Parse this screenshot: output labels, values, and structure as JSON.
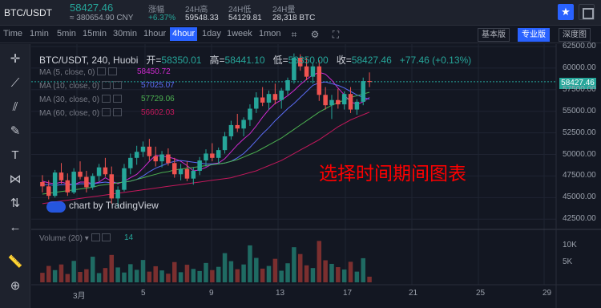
{
  "ticker": {
    "pair": "BTC/USDT",
    "price": "58427.46",
    "cny": "≈ 380654.90 CNY",
    "change_label": "涨幅",
    "change_value": "+6.37%",
    "high_label": "24H高",
    "high_value": "59548.33",
    "low_label": "24H低",
    "low_value": "54129.81",
    "volume_label": "24H量",
    "volume_value": "28,318 BTC"
  },
  "toolbar": {
    "time": "Time",
    "timeframes": [
      "1min",
      "5min",
      "15min",
      "30min",
      "1hour",
      "4hour",
      "1day",
      "1week",
      "1mon"
    ],
    "active_timeframe": "4hour",
    "views": [
      "基本版",
      "专业版",
      "深度图"
    ],
    "active_view": "专业版"
  },
  "legend": {
    "symbol": "BTC/USDT, 240, Huobi",
    "open_label": "开=",
    "open": "58350.01",
    "high_label": "高=",
    "high": "58441.10",
    "low_label": "低=",
    "low": "58350.00",
    "close_label": "收=",
    "close": "58427.46",
    "change": "+77.46 (+0.13%)",
    "ma": [
      {
        "label": "MA (5, close, 0)",
        "value": "58450.72",
        "color": "#d02ad0"
      },
      {
        "label": "MA (10, close, 0)",
        "value": "57025.07",
        "color": "#5b6cf5"
      },
      {
        "label": "MA (30, close, 0)",
        "value": "57729.06",
        "color": "#4caf50"
      },
      {
        "label": "MA (60, close, 0)",
        "value": "56602.03",
        "color": "#c2185b"
      }
    ],
    "volume_label": "Volume (20)",
    "volume_value": "14"
  },
  "watermark": "chart by TradingView",
  "overlay_text": "选择时间期间图表",
  "price_tag": "58427.46",
  "colors": {
    "up": "#26a69a",
    "down": "#ef5350",
    "accent": "#2962ff"
  },
  "icons": [
    "star-icon",
    "fullscreen-icon",
    "crosshair-icon",
    "trendline-icon",
    "fib-icon",
    "brush-icon",
    "text-icon",
    "pattern-icon",
    "measure-icon",
    "back-arrow-icon",
    "ruler-icon",
    "zoom-icon"
  ],
  "chart_data": {
    "type": "candlestick",
    "price_axis": [
      62500,
      60000,
      57500,
      55000,
      52500,
      50000,
      47500,
      45000,
      42500
    ],
    "price_axis_labels": [
      "62500.00",
      "60000.00",
      "57500.00",
      "55000.00",
      "52500.00",
      "50000.00",
      "47500.00",
      "45000.00",
      "42500.00"
    ],
    "ylim": [
      41500,
      62500
    ],
    "volume_axis_labels": [
      "10K",
      "5K"
    ],
    "x_labels": [
      "3月",
      "5",
      "9",
      "13",
      "17",
      "21",
      "25",
      "29"
    ],
    "candles": [
      [
        46800,
        47600,
        45600,
        46300
      ],
      [
        46300,
        47000,
        44800,
        45200
      ],
      [
        45200,
        48200,
        45000,
        47900
      ],
      [
        47900,
        49000,
        46600,
        47000
      ],
      [
        47000,
        47800,
        45200,
        45600
      ],
      [
        45600,
        48400,
        45400,
        48000
      ],
      [
        48000,
        49200,
        47100,
        47400
      ],
      [
        47400,
        48100,
        45600,
        46200
      ],
      [
        46200,
        47800,
        45900,
        47500
      ],
      [
        47500,
        48900,
        46900,
        48500
      ],
      [
        48500,
        49600,
        47400,
        47700
      ],
      [
        47700,
        48600,
        44300,
        44900
      ],
      [
        44900,
        46300,
        43900,
        45900
      ],
      [
        45900,
        48900,
        45700,
        48400
      ],
      [
        48400,
        50100,
        47700,
        49600
      ],
      [
        49600,
        51000,
        48800,
        50300
      ],
      [
        50300,
        51500,
        49700,
        50900
      ],
      [
        50900,
        51800,
        49300,
        49800
      ],
      [
        49800,
        50900,
        48600,
        49200
      ],
      [
        49200,
        50400,
        48500,
        50000
      ],
      [
        50000,
        50700,
        48700,
        49000
      ],
      [
        49000,
        49600,
        47300,
        47700
      ],
      [
        47700,
        48900,
        47000,
        48300
      ],
      [
        48300,
        49200,
        46900,
        47200
      ],
      [
        47200,
        48500,
        46500,
        48100
      ],
      [
        48100,
        49700,
        47600,
        49300
      ],
      [
        49300,
        50600,
        48600,
        50100
      ],
      [
        50100,
        51300,
        49200,
        49600
      ],
      [
        49600,
        50800,
        48900,
        50500
      ],
      [
        50500,
        52600,
        50100,
        52100
      ],
      [
        52100,
        53900,
        51700,
        53400
      ],
      [
        53400,
        54700,
        52600,
        53000
      ],
      [
        53000,
        54300,
        52100,
        54000
      ],
      [
        54000,
        55800,
        53300,
        55300
      ],
      [
        55300,
        57200,
        54800,
        56600
      ],
      [
        56600,
        57800,
        55600,
        56000
      ],
      [
        56000,
        57400,
        55200,
        57000
      ],
      [
        57000,
        58200,
        55800,
        56300
      ],
      [
        56300,
        57700,
        55300,
        57400
      ],
      [
        57400,
        58900,
        56900,
        58600
      ],
      [
        58600,
        61700,
        58200,
        61200
      ],
      [
        61200,
        61600,
        59700,
        60200
      ],
      [
        60200,
        61200,
        58600,
        59000
      ],
      [
        59000,
        60600,
        58200,
        60200
      ],
      [
        60200,
        60900,
        56200,
        56900
      ],
      [
        56900,
        57800,
        55200,
        55700
      ],
      [
        55700,
        56900,
        54100,
        56300
      ],
      [
        56300,
        57600,
        55300,
        55800
      ],
      [
        55800,
        57300,
        55200,
        57000
      ],
      [
        57000,
        57800,
        54800,
        55200
      ],
      [
        55200,
        56400,
        54600,
        56100
      ],
      [
        56100,
        58900,
        55700,
        58500
      ],
      [
        58500,
        59500,
        57800,
        58400
      ]
    ],
    "volume": [
      3.2,
      5.5,
      4.1,
      6.0,
      2.8,
      7.2,
      3.5,
      4.4,
      8.6,
      3.1,
      4.8,
      9.2,
      5.0,
      3.3,
      6.1,
      4.2,
      7.5,
      3.6,
      5.4,
      4.0,
      2.9,
      6.8,
      3.4,
      5.9,
      4.5,
      3.8,
      6.5,
      4.1,
      5.2,
      9.8,
      7.1,
      4.4,
      6.0,
      12.4,
      8.2,
      4.6,
      5.5,
      7.9,
      3.9,
      6.4,
      11.8,
      9.5,
      5.7,
      4.8,
      13.9,
      7.4,
      6.2,
      5.1,
      4.3,
      6.9,
      3.6,
      8.1,
      1.9
    ],
    "ma_lines": {
      "ma5": [
        46900,
        46700,
        46600,
        46800,
        46600,
        46500,
        46800,
        46800,
        46600,
        46800,
        47300,
        46900,
        46600,
        46900,
        47300,
        47700,
        48400,
        49200,
        49900,
        49800,
        49700,
        49500,
        49200,
        48700,
        48100,
        48200,
        48500,
        48900,
        49000,
        49500,
        50300,
        51100,
        51800,
        52400,
        53300,
        54300,
        55200,
        55900,
        56300,
        56800,
        57400,
        58100,
        58700,
        59200,
        59500,
        59300,
        58600,
        57700,
        56900,
        56100,
        55800,
        56100,
        56600
      ],
      "ma10": [
        46500,
        46500,
        46400,
        46500,
        46500,
        46500,
        46600,
        46600,
        46600,
        46700,
        46800,
        46700,
        46700,
        46800,
        46900,
        47100,
        47500,
        48000,
        48400,
        48700,
        49000,
        49200,
        49300,
        49200,
        49100,
        49000,
        48900,
        48900,
        48900,
        49000,
        49200,
        49600,
        50100,
        50800,
        51600,
        52400,
        53100,
        53900,
        54600,
        55300,
        55900,
        56600,
        57300,
        58000,
        58300,
        58400,
        58200,
        58000,
        57700,
        57300,
        56900,
        56600,
        56400
      ],
      "ma30": [
        45400,
        45500,
        45600,
        45700,
        45800,
        45900,
        46000,
        46100,
        46200,
        46400,
        46500,
        46600,
        46700,
        46800,
        46900,
        47100,
        47300,
        47500,
        47700,
        47900,
        48000,
        48200,
        48300,
        48400,
        48500,
        48600,
        48700,
        48800,
        48900,
        49000,
        49200,
        49400,
        49700,
        50000,
        50300,
        50700,
        51100,
        51500,
        51900,
        52400,
        52900,
        53400,
        53900,
        54400,
        54900,
        55300,
        55700,
        56000,
        56300,
        56600,
        56800,
        57000,
        57200
      ],
      "ma60": [
        44300,
        44400,
        44500,
        44600,
        44700,
        44800,
        44900,
        45000,
        45100,
        45200,
        45300,
        45400,
        45500,
        45600,
        45700,
        45800,
        45900,
        46000,
        46100,
        46200,
        46300,
        46400,
        46500,
        46600,
        46700,
        46800,
        46900,
        47000,
        47100,
        47200,
        47300,
        47500,
        47700,
        47900,
        48100,
        48400,
        48700,
        49000,
        49300,
        49700,
        50100,
        50500,
        50900,
        51300,
        51700,
        52200,
        52700,
        53200,
        53600,
        54000,
        54300,
        54600,
        54900
      ]
    }
  }
}
